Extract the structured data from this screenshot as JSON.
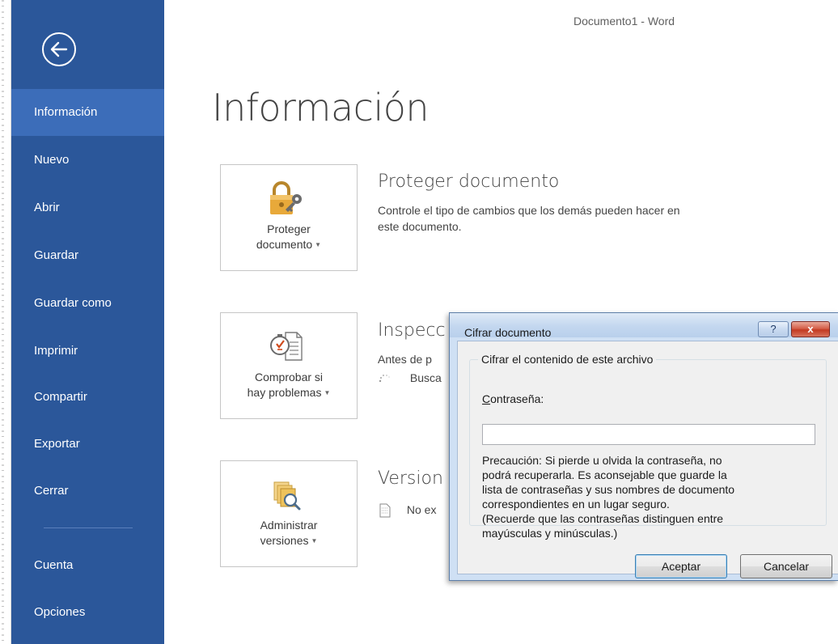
{
  "window": {
    "title": "Documento1 - Word"
  },
  "nav": {
    "back_icon": "back-arrow-icon",
    "items": [
      {
        "label": "Información",
        "active": true
      },
      {
        "label": "Nuevo"
      },
      {
        "label": "Abrir"
      },
      {
        "label": "Guardar"
      },
      {
        "label": "Guardar como"
      },
      {
        "label": "Imprimir"
      },
      {
        "label": "Compartir"
      },
      {
        "label": "Exportar"
      },
      {
        "label": "Cerrar"
      },
      {
        "label": "Cuenta"
      },
      {
        "label": "Opciones"
      }
    ],
    "colors": {
      "background": "#2b579a",
      "active": "#3c6db9"
    }
  },
  "main": {
    "title": "Información",
    "sections": [
      {
        "tile_icon": "lock-key-icon",
        "tile_label_line1": "Proteger",
        "tile_label_line2": "documento",
        "heading": "Proteger documento",
        "text_line1": "Controle el tipo de cambios que los demás pueden hacer en",
        "text_line2": "este documento."
      },
      {
        "tile_icon": "inspect-document-icon",
        "tile_label_line1": "Comprobar si",
        "tile_label_line2": "hay problemas",
        "heading": "Inspecc",
        "text_line1": "Antes de p",
        "text_line2": "Busca",
        "spinner_icon": "loading-spinner-icon"
      },
      {
        "tile_icon": "versions-icon",
        "tile_label_line1": "Administrar",
        "tile_label_line2": "versiones",
        "heading": "Version",
        "text_line1": "No ex",
        "row_icon": "document-icon"
      }
    ]
  },
  "dialog": {
    "title": "Cifrar documento",
    "help_label": "?",
    "close_label": "x",
    "group_label": "Cifrar el contenido de este archivo",
    "password_label_accel": "C",
    "password_label_rest": "ontraseña:",
    "password_value": "",
    "caution_lines": [
      "Precaución: Si pierde u olvida la contraseña, no",
      "podrá recuperarla. Es aconsejable que guarde la",
      "lista de contraseñas y sus nombres de documento",
      "correspondientes en un lugar seguro.",
      "(Recuerde que las contraseñas distinguen entre",
      "mayúsculas y minúsculas.)"
    ],
    "ok_label": "Aceptar",
    "cancel_label": "Cancelar"
  }
}
